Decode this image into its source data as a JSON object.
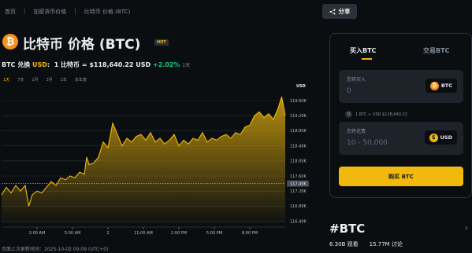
{
  "breadcrumb": [
    "首页",
    "加密货币价格",
    "比特币 价格 (BTC)"
  ],
  "share_label": "分享",
  "coin_glyph": "₿",
  "title": "比特币 价格 (BTC)",
  "hot_badge": "HOT",
  "conversion": {
    "pair": "BTC 兑换",
    "usd": "USD",
    "colon": ":",
    "rate": "1 比特币 = $118,640.22 USD",
    "change": "+2.02%",
    "period": "1天"
  },
  "ranges": [
    "1天",
    "7天",
    "1月",
    "3月",
    "1年",
    "本年度"
  ],
  "last_update": "页面上次更新时间：2025-10-02 09:09 (UTC+0)",
  "colors": {
    "accent": "#f0b90b",
    "up": "#0ecb81",
    "btc": "#f7931a",
    "usd": "#f0b90b",
    "bg": "#0b0e11"
  },
  "chart_data": {
    "type": "area",
    "currency_label": "USD",
    "x_tick_labels": [
      "2:00 AM",
      "5:00 AM",
      "2",
      "11:00 AM",
      "2:00 PM",
      "5:00 PM",
      "8:00 PM"
    ],
    "y_tick_labels": [
      "119.60K",
      "119.20K",
      "118.80K",
      "118.40K",
      "118.00K",
      "117.60K",
      "117.20K",
      "116.80K",
      "116.40K"
    ],
    "y_ticks": [
      119.6,
      119.2,
      118.8,
      118.4,
      118.0,
      117.6,
      117.2,
      116.8,
      116.4
    ],
    "ylim": [
      116.35,
      119.85
    ],
    "current_label": "117.40K",
    "current_value": 117.4,
    "x_tick_positions": [
      3.0,
      6.0,
      9.0,
      12.0,
      15.0,
      18.0,
      21.0
    ],
    "x_range": [
      0,
      24
    ],
    "x": [
      0,
      0.4,
      0.8,
      1.2,
      1.6,
      2.0,
      2.3,
      2.6,
      3.0,
      3.4,
      3.8,
      4.2,
      4.6,
      5.0,
      5.4,
      5.8,
      6.2,
      6.6,
      7.0,
      7.2,
      7.4,
      7.8,
      8.2,
      8.6,
      9.0,
      9.4,
      9.8,
      10.2,
      10.6,
      11.0,
      11.4,
      11.8,
      12.2,
      12.6,
      13.0,
      13.4,
      13.8,
      14.2,
      14.6,
      15.0,
      15.4,
      15.8,
      16.2,
      16.6,
      17.0,
      17.4,
      17.8,
      18.2,
      18.6,
      19.0,
      19.4,
      19.8,
      20.2,
      20.6,
      21.0,
      21.4,
      21.8,
      22.2,
      22.6,
      23.0,
      23.4,
      23.7,
      24.0
    ],
    "values": [
      117.1,
      117.3,
      117.15,
      117.35,
      117.2,
      117.35,
      116.8,
      117.1,
      117.2,
      117.15,
      117.3,
      117.45,
      117.35,
      117.55,
      117.5,
      117.6,
      117.55,
      117.7,
      117.65,
      118.1,
      117.9,
      117.95,
      118.1,
      118.5,
      118.35,
      119.0,
      118.7,
      118.4,
      118.6,
      118.5,
      118.65,
      118.7,
      118.55,
      118.75,
      118.5,
      118.6,
      118.45,
      118.55,
      118.7,
      118.4,
      118.55,
      118.45,
      118.6,
      118.55,
      118.75,
      118.5,
      118.6,
      118.55,
      118.65,
      118.7,
      118.6,
      118.75,
      118.7,
      118.9,
      118.95,
      119.2,
      119.3,
      119.15,
      119.25,
      119.1,
      119.4,
      119.7,
      119.2
    ]
  },
  "panel": {
    "tab_buy": "买入BTC",
    "tab_trade": "交易BTC",
    "spend_label": "您将买入",
    "spend_value": "0",
    "spend_currency": "BTC",
    "rate_note": "1 BTC ≈ USD $118,640.22",
    "receive_label": "您将花费",
    "receive_placeholder": "10 - 50,000",
    "receive_currency": "USD",
    "buy_button": "购买 BTC"
  },
  "tag": {
    "name": "#BTC",
    "views": "6.30B 观看",
    "discussions": "15.77M 讨论"
  }
}
